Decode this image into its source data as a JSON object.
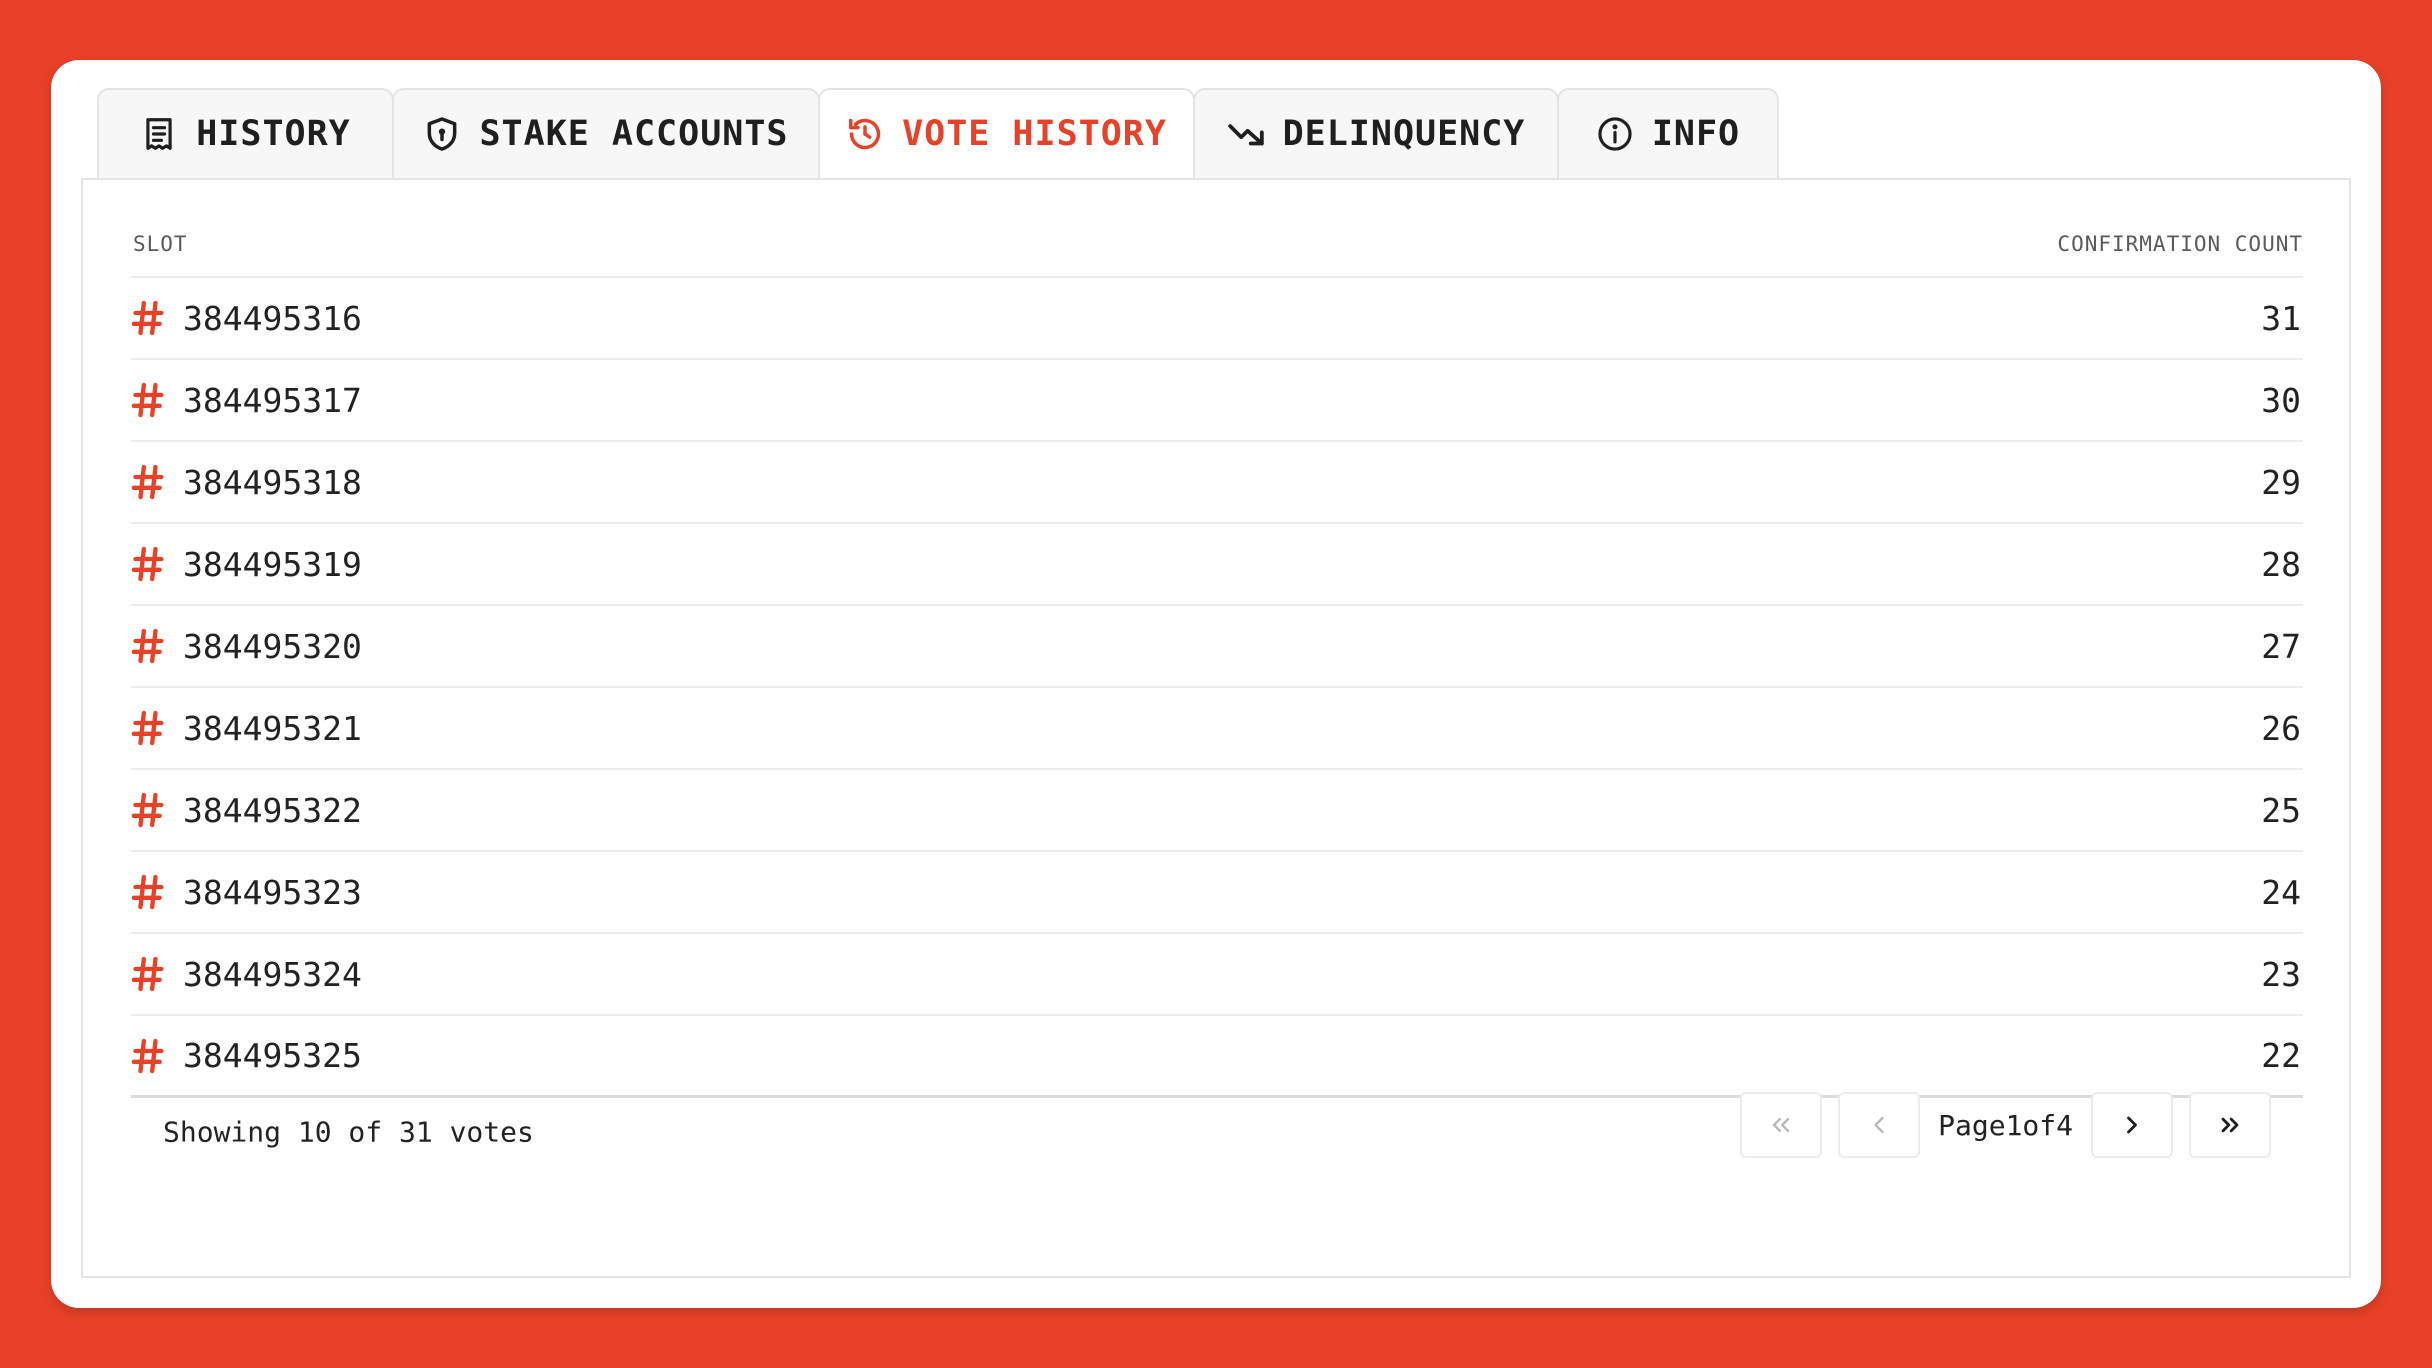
{
  "colors": {
    "accent": "#e84128",
    "background": "#e84128",
    "card": "#ffffff"
  },
  "tabs": [
    {
      "label": "HISTORY",
      "icon": "document-icon",
      "active": false
    },
    {
      "label": "STAKE ACCOUNTS",
      "icon": "shield-icon",
      "active": false
    },
    {
      "label": "VOTE HISTORY",
      "icon": "history-icon",
      "active": true
    },
    {
      "label": "DELINQUENCY",
      "icon": "trending-down-icon",
      "active": false
    },
    {
      "label": "INFO",
      "icon": "info-icon",
      "active": false
    }
  ],
  "table": {
    "columns": {
      "slot": "SLOT",
      "count": "CONFIRMATION COUNT"
    },
    "rows": [
      {
        "slot": "384495316",
        "count": "31"
      },
      {
        "slot": "384495317",
        "count": "30"
      },
      {
        "slot": "384495318",
        "count": "29"
      },
      {
        "slot": "384495319",
        "count": "28"
      },
      {
        "slot": "384495320",
        "count": "27"
      },
      {
        "slot": "384495321",
        "count": "26"
      },
      {
        "slot": "384495322",
        "count": "25"
      },
      {
        "slot": "384495323",
        "count": "24"
      },
      {
        "slot": "384495324",
        "count": "23"
      },
      {
        "slot": "384495325",
        "count": "22"
      }
    ]
  },
  "footer": {
    "showing": "Showing 10 of 31 votes",
    "page_label": "Page",
    "page_current": "1",
    "page_of": "of",
    "page_total": "4"
  }
}
